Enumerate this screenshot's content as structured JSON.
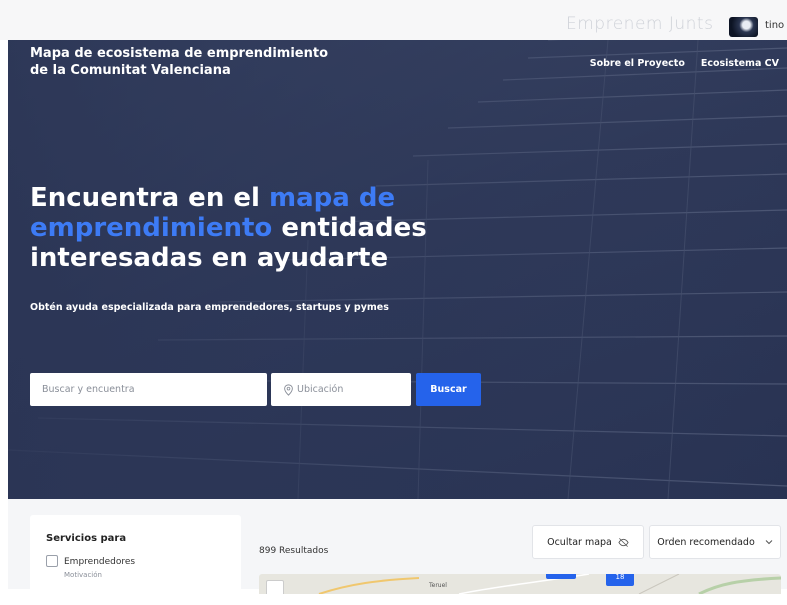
{
  "header": {
    "brand": "Emprenem Junts",
    "username": "tino"
  },
  "hero": {
    "site_title": "Mapa de ecosistema de emprendimiento de la Comunitat Valenciana",
    "nav": [
      "Sobre el Proyecto",
      "Ecosistema CV"
    ],
    "headline_part1": "Encuentra en el ",
    "headline_highlight": "mapa de emprendimiento",
    "headline_part2": " entidades interesadas en ayudarte",
    "subline": "Obtén ayuda especializada para emprendedores, startups y pymes",
    "search_placeholder": "Buscar y encuentra",
    "location_placeholder": "Ubicación",
    "search_button": "Buscar"
  },
  "filters": {
    "title": "Servicios para",
    "option_label": "Emprendedores",
    "option_sub": "Motivación"
  },
  "results": {
    "count_text": "899 Resultados",
    "hide_map": "Ocultar mapa",
    "order": "Orden recomendado"
  },
  "map": {
    "label": "Teruel",
    "cluster": "18"
  },
  "colors": {
    "accent": "#2563eb",
    "highlight": "#3d7bf5",
    "hero_overlay": "#2d3757"
  }
}
